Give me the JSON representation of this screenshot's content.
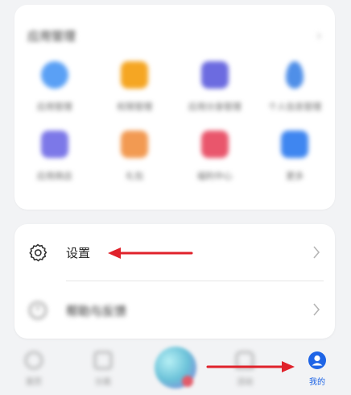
{
  "app_section": {
    "title": "应用管理",
    "apps": [
      {
        "label": "应用管理",
        "icon": "circle-blue-icon",
        "color": "#5aa0f5",
        "shape": "circle"
      },
      {
        "label": "权限管理",
        "icon": "shield-orange-icon",
        "color": "#f5a623",
        "shape": "sq"
      },
      {
        "label": "应用分身管理",
        "icon": "purple-app-icon",
        "color": "#6c6be0",
        "shape": "sq"
      },
      {
        "label": "个人信息管理",
        "icon": "blue-balloon-icon",
        "color": "#4f8fe8",
        "shape": "circle"
      },
      {
        "label": "应用商店",
        "icon": "purple-store-icon",
        "color": "#7c78e8",
        "shape": "sq"
      },
      {
        "label": "礼包",
        "icon": "orange-bag-icon",
        "color": "#f29a52",
        "shape": "sq"
      },
      {
        "label": "福利中心",
        "icon": "red-gift-icon",
        "color": "#e9566c",
        "shape": "sq"
      },
      {
        "label": "更多",
        "icon": "blue-grid-icon",
        "color": "#3f86f0",
        "shape": "sq"
      }
    ]
  },
  "settings_card": {
    "settings_label": "设置",
    "help_label": "帮助与反馈"
  },
  "nav": {
    "items": [
      {
        "label": "首页"
      },
      {
        "label": "分类"
      },
      {
        "label": "活动"
      },
      {
        "label": "我的"
      }
    ],
    "active_color": "#1e64e6"
  },
  "annotation_color": "#e0222b"
}
